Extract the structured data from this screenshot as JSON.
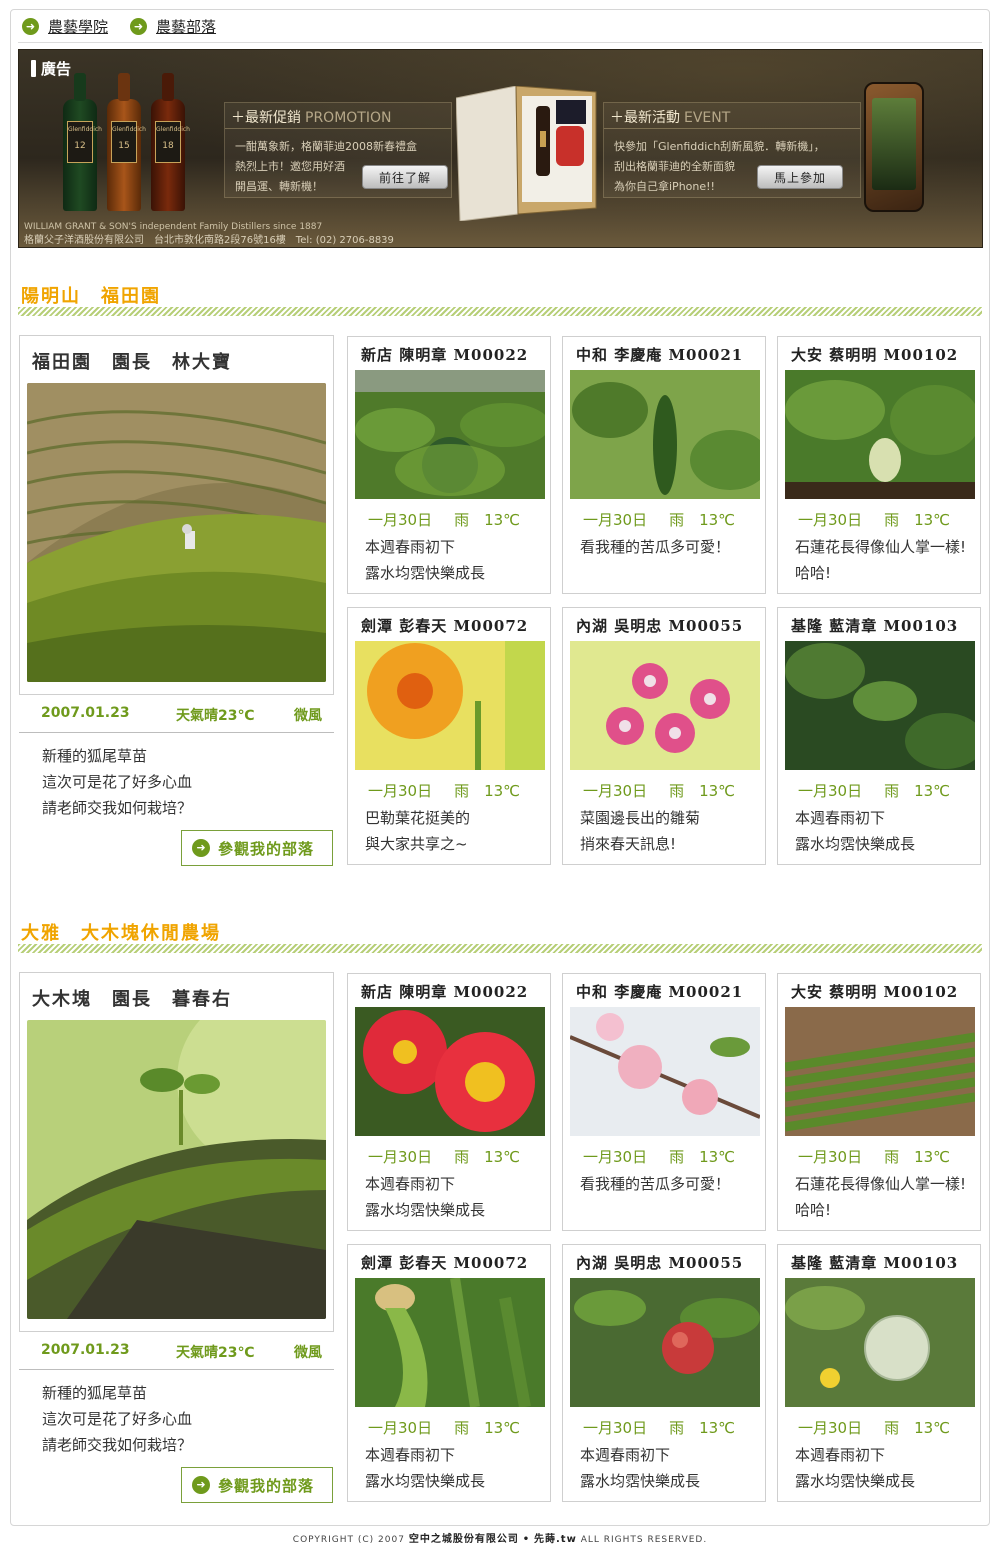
{
  "nav": {
    "items": [
      {
        "label": "農藝學院"
      },
      {
        "label": "農藝部落"
      }
    ]
  },
  "ad": {
    "tag": "廣告",
    "promotion": {
      "title": "最新促銷",
      "title_en": "PROMOTION",
      "text": [
        "一酣萬象新，格蘭菲迪2008新春禮盒",
        "熱烈上市！邀您用好酒",
        "開昌運、轉新機！"
      ],
      "button": "前往了解"
    },
    "event": {
      "title": "最新活動",
      "title_en": "EVENT",
      "text": [
        "快參加「Glenfiddich刮新風貌．轉新機」，",
        "刮出格蘭菲迪的全新面貌",
        "為你自己拿iPhone!!"
      ],
      "button": "馬上參加"
    },
    "footer_line1": "WILLIAM GRANT & SON'S independent Family Distillers since 1887",
    "footer_line2": "格蘭父子洋酒股份有限公司　台北市敦化南路2段76號16樓　Tel: (02) 2706-8839",
    "bottle_labels": [
      "12",
      "15",
      "18"
    ],
    "bottle_brand": "Glenfiddich"
  },
  "sections": [
    {
      "title": "陽明山　福田園",
      "feature": {
        "title": "福田園　園長　林大寶",
        "date": "2007.01.23",
        "weather": "天氣晴23℃",
        "wind": "微風",
        "desc": [
          "新種的狐尾草苗",
          "這次可是花了好多心血",
          "請老師交我如何栽培？"
        ],
        "button": "參觀我的部落"
      },
      "cards": [
        {
          "title": "新店 陳明章 M00022",
          "date": "一月30日",
          "weather": "雨　13℃",
          "text": [
            "本週春雨初下",
            "露水均霑快樂成長"
          ],
          "photo": "cabbage"
        },
        {
          "title": "中和 李慶庵 M00021",
          "date": "一月30日",
          "weather": "雨　13℃",
          "text": [
            "看我種的苦瓜多可愛！"
          ],
          "photo": "bitter-melon"
        },
        {
          "title": "大安 蔡明明 M00102",
          "date": "一月30日",
          "weather": "雨　13℃",
          "text": [
            "石蓮花長得像仙人掌一樣! 哈哈!"
          ],
          "photo": "radish"
        },
        {
          "title": "劍潭 彭春天 M00072",
          "date": "一月30日",
          "weather": "雨　13℃",
          "text": [
            "巴勒葉花挺美的",
            "與大家共享之~"
          ],
          "photo": "orange-gerbera"
        },
        {
          "title": "內湖 吳明忠 M00055",
          "date": "一月30日",
          "weather": "雨　13℃",
          "text": [
            "菜園邊長出的雛菊",
            "捎來春天訊息!"
          ],
          "photo": "pink-daisies"
        },
        {
          "title": "基隆 藍清章 M00103",
          "date": "一月30日",
          "weather": "雨　13℃",
          "text": [
            "本週春雨初下",
            "露水均霑快樂成長"
          ],
          "photo": "seedling"
        }
      ]
    },
    {
      "title": "大雅　大木塊休閒農場",
      "feature": {
        "title": "大木塊　園長　暮春右",
        "date": "2007.01.23",
        "weather": "天氣晴23℃",
        "wind": "微風",
        "desc": [
          "新種的狐尾草苗",
          "這次可是花了好多心血",
          "請老師交我如何栽培？"
        ],
        "button": "參觀我的部落"
      },
      "cards": [
        {
          "title": "新店 陳明章 M00022",
          "date": "一月30日",
          "weather": "雨　13℃",
          "text": [
            "本週春雨初下",
            "露水均霑快樂成長"
          ],
          "photo": "red-flowers"
        },
        {
          "title": "中和 李慶庵 M00021",
          "date": "一月30日",
          "weather": "雨　13℃",
          "text": [
            "看我種的苦瓜多可愛！"
          ],
          "photo": "peach-blossom"
        },
        {
          "title": "大安 蔡明明 M00102",
          "date": "一月30日",
          "weather": "雨　13℃",
          "text": [
            "石蓮花長得像仙人掌一樣! 哈哈!"
          ],
          "photo": "asparagus"
        },
        {
          "title": "劍潭 彭春天 M00072",
          "date": "一月30日",
          "weather": "雨　13℃",
          "text": [
            "本週春雨初下",
            "露水均霑快樂成長"
          ],
          "photo": "corn"
        },
        {
          "title": "內湖 吳明忠 M00055",
          "date": "一月30日",
          "weather": "雨　13℃",
          "text": [
            "本週春雨初下",
            "露水均霑快樂成長"
          ],
          "photo": "apple"
        },
        {
          "title": "基隆 藍清章 M00103",
          "date": "一月30日",
          "weather": "雨　13℃",
          "text": [
            "本週春雨初下",
            "露水均霑快樂成長"
          ],
          "photo": "melon"
        }
      ]
    }
  ],
  "footer": {
    "prefix": "COPYRIGHT (C) 2007",
    "company": "空中之城股份有限公司",
    "sep": "•",
    "brand": "先蒔.tw",
    "suffix": "ALL RIGHTS RESERVED."
  },
  "colors": {
    "accent_green": "#6f9a1c",
    "section_orange": "#f0a400"
  }
}
